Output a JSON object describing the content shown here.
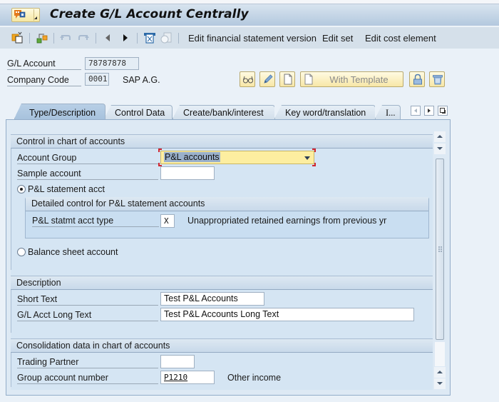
{
  "window": {
    "title": "Create G/L Account Centrally",
    "menu_icon": "sap-menu-icon"
  },
  "toolbar": {
    "icons": [
      "other-object-icon",
      "switch-icon",
      "undo-icon",
      "redo-icon",
      "previous-icon",
      "next-icon",
      "print-icon",
      "display-document-icon"
    ],
    "buttons": [
      "Edit financial statement version",
      "Edit set",
      "Edit cost element"
    ]
  },
  "header": {
    "gl_account_label": "G/L Account",
    "gl_account_value": "78787878",
    "company_code_label": "Company Code",
    "company_code_value": "0001",
    "company_name": "SAP A.G.",
    "actions": {
      "display_icon": "glasses-icon",
      "change_icon": "pencil-icon",
      "create_icon": "blank-page-icon",
      "with_template_label": "With Template",
      "lock_icon": "lock-icon",
      "delete_icon": "trash-icon"
    }
  },
  "tabs": {
    "items": [
      {
        "label": "Type/Description",
        "active": true
      },
      {
        "label": "Control Data",
        "active": false
      },
      {
        "label": "Create/bank/interest",
        "active": false
      },
      {
        "label": "Key word/translation",
        "active": false
      },
      {
        "label": "I...",
        "active": false
      }
    ]
  },
  "control_section": {
    "title": "Control in chart of accounts",
    "account_group_label": "Account Group",
    "account_group_value": "P&L accounts",
    "sample_account_label": "Sample account",
    "sample_account_value": "",
    "pl_radio_label": "P&L statement acct",
    "pl_radio_selected": true,
    "detail_title": "Detailed control for P&L statement accounts",
    "pl_type_label": "P&L statmt acct type",
    "pl_type_value": "X",
    "pl_type_desc": "Unappropriated retained earnings from previous yr",
    "bs_radio_label": "Balance sheet account",
    "bs_radio_selected": false
  },
  "description_section": {
    "title": "Description",
    "short_text_label": "Short Text",
    "short_text_value": "Test P&L Accounts",
    "long_text_label": "G/L Acct Long Text",
    "long_text_value": "Test P&L Accounts Long Text"
  },
  "consolidation_section": {
    "title": "Consolidation data in chart of accounts",
    "trading_partner_label": "Trading Partner",
    "trading_partner_value": "",
    "group_account_label": "Group account number",
    "group_account_value": "P1210",
    "group_account_desc": "Other income"
  },
  "colors": {
    "title_bar": "#b3c8de",
    "accent_yellow": "#fdeea0",
    "focus_red": "#d0262e"
  }
}
